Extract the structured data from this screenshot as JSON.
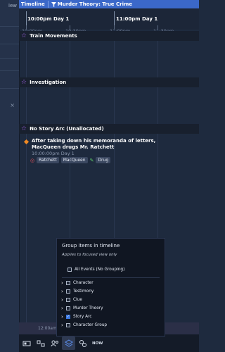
{
  "left_pane": {
    "tab_label": "iew",
    "close_glyph": "×"
  },
  "header": {
    "tab_timeline": "Timeline",
    "filter_icon": "filter-icon",
    "view_title": "Murder Theory: True Crime"
  },
  "ruler": {
    "major": [
      "10:00pm Day 1",
      "11:00pm Day 1"
    ],
    "minor": [
      "10:00pm",
      "10:30pm",
      "11:00pm",
      "11:30pm"
    ]
  },
  "arcs": [
    "Train Movements",
    "Investigation",
    "No Story Arc (Unallocated)"
  ],
  "event": {
    "title": "After taking down his memoranda of letters, MacQueen drugs Mr. Ratchett",
    "time": "10:00:00pm Day 1",
    "tags": [
      "Ratchett",
      "MacQueen",
      "Drug"
    ]
  },
  "now_strip": {
    "label": "12:00am D"
  },
  "bottom_bar": {
    "now_label": "NOW"
  },
  "group_popup": {
    "title": "Group items in timeline",
    "subtitle": "Applies to focused view only",
    "all_events": "All Events (No Grouping)",
    "options": [
      {
        "label": "Character",
        "checked": false
      },
      {
        "label": "Testimony",
        "checked": false
      },
      {
        "label": "Clue",
        "checked": false
      },
      {
        "label": "Murder Theory",
        "checked": false
      },
      {
        "label": "Story Arc",
        "checked": true
      },
      {
        "label": "Character Group",
        "checked": false
      }
    ]
  },
  "colors": {
    "accent": "#3b68c9",
    "arc_star": "#b36bff",
    "event_diamond": "#f08a24",
    "checkbox_checked": "#3b78e0"
  }
}
